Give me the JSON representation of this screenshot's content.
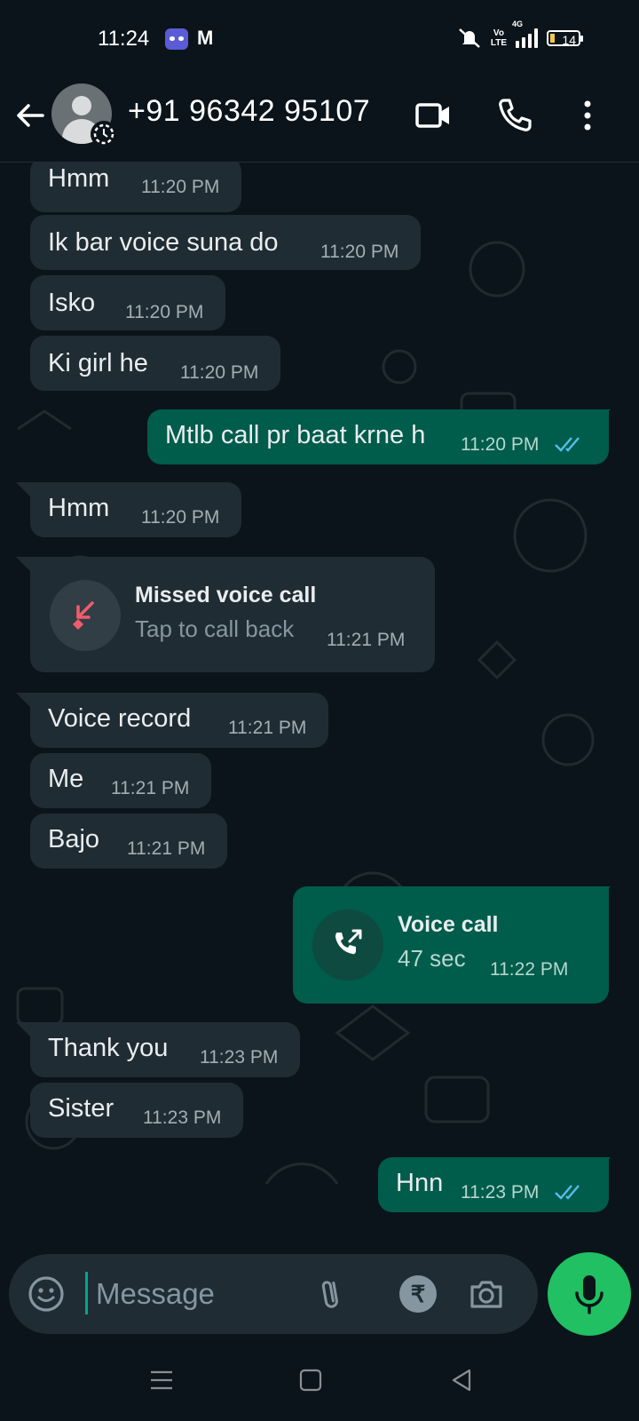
{
  "status_bar": {
    "time": "11:24",
    "app2": "M",
    "volte_top": "Vo",
    "volte_bottom": "LTE",
    "network": "4G",
    "battery": "14"
  },
  "header": {
    "contact_name": "+91 96342 95107"
  },
  "messages": [
    {
      "dir": "in",
      "text": "Hmm",
      "time": "11:20 PM"
    },
    {
      "dir": "in",
      "text": "Ik bar voice suna do",
      "time": "11:20 PM"
    },
    {
      "dir": "in",
      "text": "Isko",
      "time": "11:20 PM"
    },
    {
      "dir": "in",
      "text": "Ki girl he",
      "time": "11:20 PM"
    },
    {
      "dir": "out",
      "text": "Mtlb call pr baat krne h",
      "time": "11:20 PM"
    },
    {
      "dir": "in",
      "text": "Hmm",
      "time": "11:20 PM"
    },
    {
      "dir": "in",
      "type": "missed-call",
      "title": "Missed voice call",
      "subtitle": "Tap to call back",
      "time": "11:21 PM"
    },
    {
      "dir": "in",
      "text": "Voice record",
      "time": "11:21 PM"
    },
    {
      "dir": "in",
      "text": "Me",
      "time": "11:21 PM"
    },
    {
      "dir": "in",
      "text": "Bajo",
      "time": "11:21 PM"
    },
    {
      "dir": "out",
      "type": "voice-call",
      "title": "Voice call",
      "subtitle": "47 sec",
      "time": "11:22 PM"
    },
    {
      "dir": "in",
      "text": "Thank you",
      "time": "11:23 PM"
    },
    {
      "dir": "in",
      "text": "Sister",
      "time": "11:23 PM"
    },
    {
      "dir": "out",
      "text": "Hnn",
      "time": "11:23 PM"
    }
  ],
  "composer": {
    "placeholder": "Message",
    "rupee_symbol": "₹"
  },
  "colors": {
    "incoming": "#202c33",
    "outgoing": "#005c4b",
    "accent": "#21c063",
    "read_ticks": "#53bdeb",
    "missed": "#f15c6d"
  },
  "icons": [
    "back-arrow-icon",
    "video-call-icon",
    "phone-icon",
    "more-options-icon",
    "emoji-icon",
    "attach-icon",
    "rupee-icon",
    "camera-icon",
    "mic-icon",
    "missed-call-icon",
    "outgoing-call-icon",
    "double-check-icon"
  ]
}
